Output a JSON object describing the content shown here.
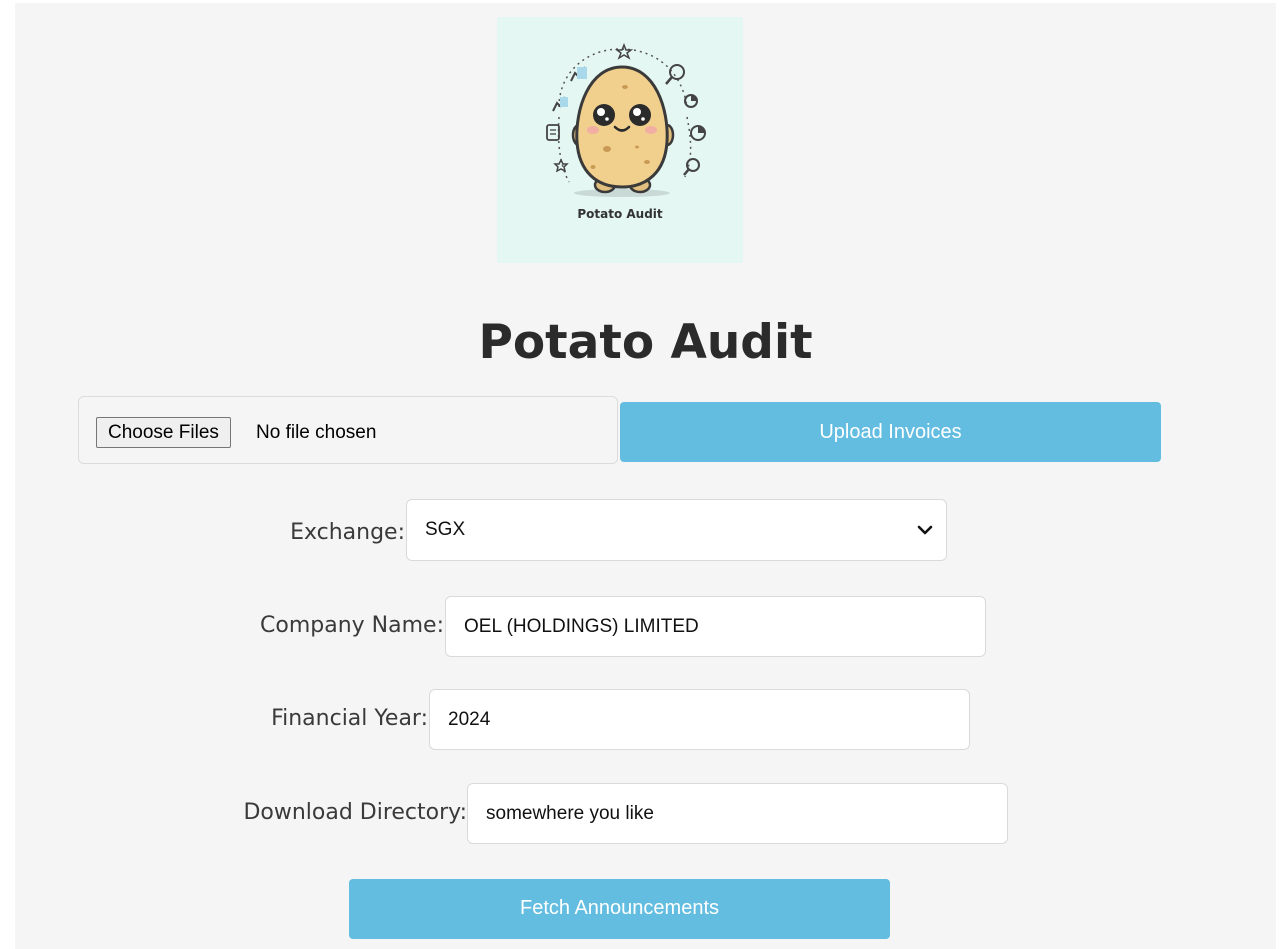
{
  "app": {
    "logo_caption": "Potato Audit",
    "title": "Potato Audit"
  },
  "upload": {
    "choose_label": "Choose Files",
    "file_status": "No file chosen",
    "upload_label": "Upload Invoices"
  },
  "form": {
    "exchange_label": "Exchange:",
    "exchange_value": "SGX",
    "company_label": "Company Name:",
    "company_value": "OEL (HOLDINGS) LIMITED",
    "year_label": "Financial Year:",
    "year_value": "2024",
    "directory_label": "Download Directory:",
    "directory_value": "somewhere you like",
    "fetch_label": "Fetch Announcements"
  },
  "colors": {
    "accent": "#63bde0",
    "page_background": "#f4f5f4",
    "logo_background": "#e4f7f3"
  }
}
